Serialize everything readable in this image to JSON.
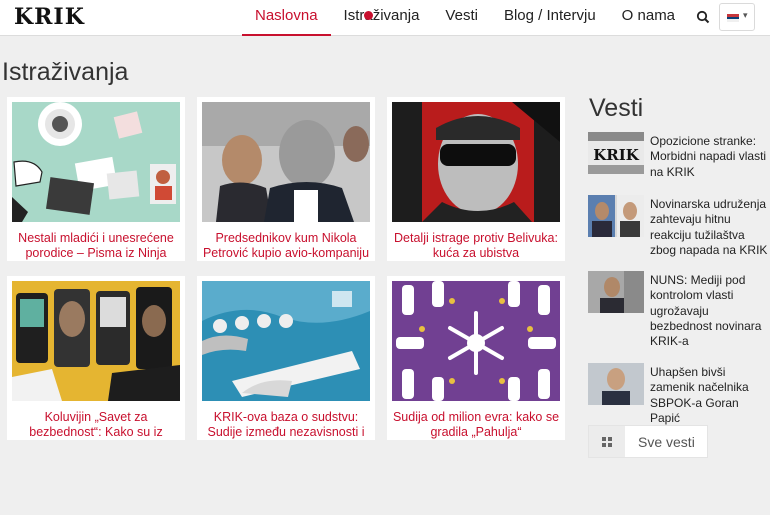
{
  "header": {
    "logo": "KRIK",
    "nav": [
      {
        "label": "Naslovna",
        "active": true
      },
      {
        "label": "Istraživanja",
        "active": false
      },
      {
        "label": "Vesti",
        "active": false
      },
      {
        "label": "Blog / Intervju",
        "active": false
      },
      {
        "label": "O nama",
        "active": false
      }
    ],
    "search_icon": "search-icon",
    "language_flag": "serbia-flag-icon"
  },
  "section": {
    "title": "Istraživanja"
  },
  "articles": [
    {
      "title": "Nestali mladići i unesrećene porodice – Pisma iz Ninja"
    },
    {
      "title": "Predsednikov kum Nikola Petrović kupio avio-kompaniju"
    },
    {
      "title": "Detalji istrage protiv Belivuka: kuća za ubistva"
    },
    {
      "title": "Koluvijin „Savet za bezbednost“: Kako su iz zatvora"
    },
    {
      "title": "KRIK-ova baza o sudstvu: Sudije između nezavisnosti i"
    },
    {
      "title": "Sudija od milion evra: kako se gradila „Pahulja“"
    }
  ],
  "sidebar": {
    "title": "Vesti",
    "news": [
      {
        "text": "Opozicione stranke: Morbidni napadi vlasti na KRIK",
        "thumb_label": "KRIK"
      },
      {
        "text": "Novinarska udruženja zahtevaju hitnu reakciju tužilaštva zbog napada na KRIK"
      },
      {
        "text": "NUNS: Mediji pod kontrolom vlasti ugrožavaju bezbednost novinara KRIK-a"
      },
      {
        "text": "Uhapšen bivši zamenik načelnika SBPOK-a Goran Papić"
      }
    ],
    "all_news_label": "Sve vesti"
  },
  "colors": {
    "accent": "#c8102e",
    "background": "#efefef"
  }
}
